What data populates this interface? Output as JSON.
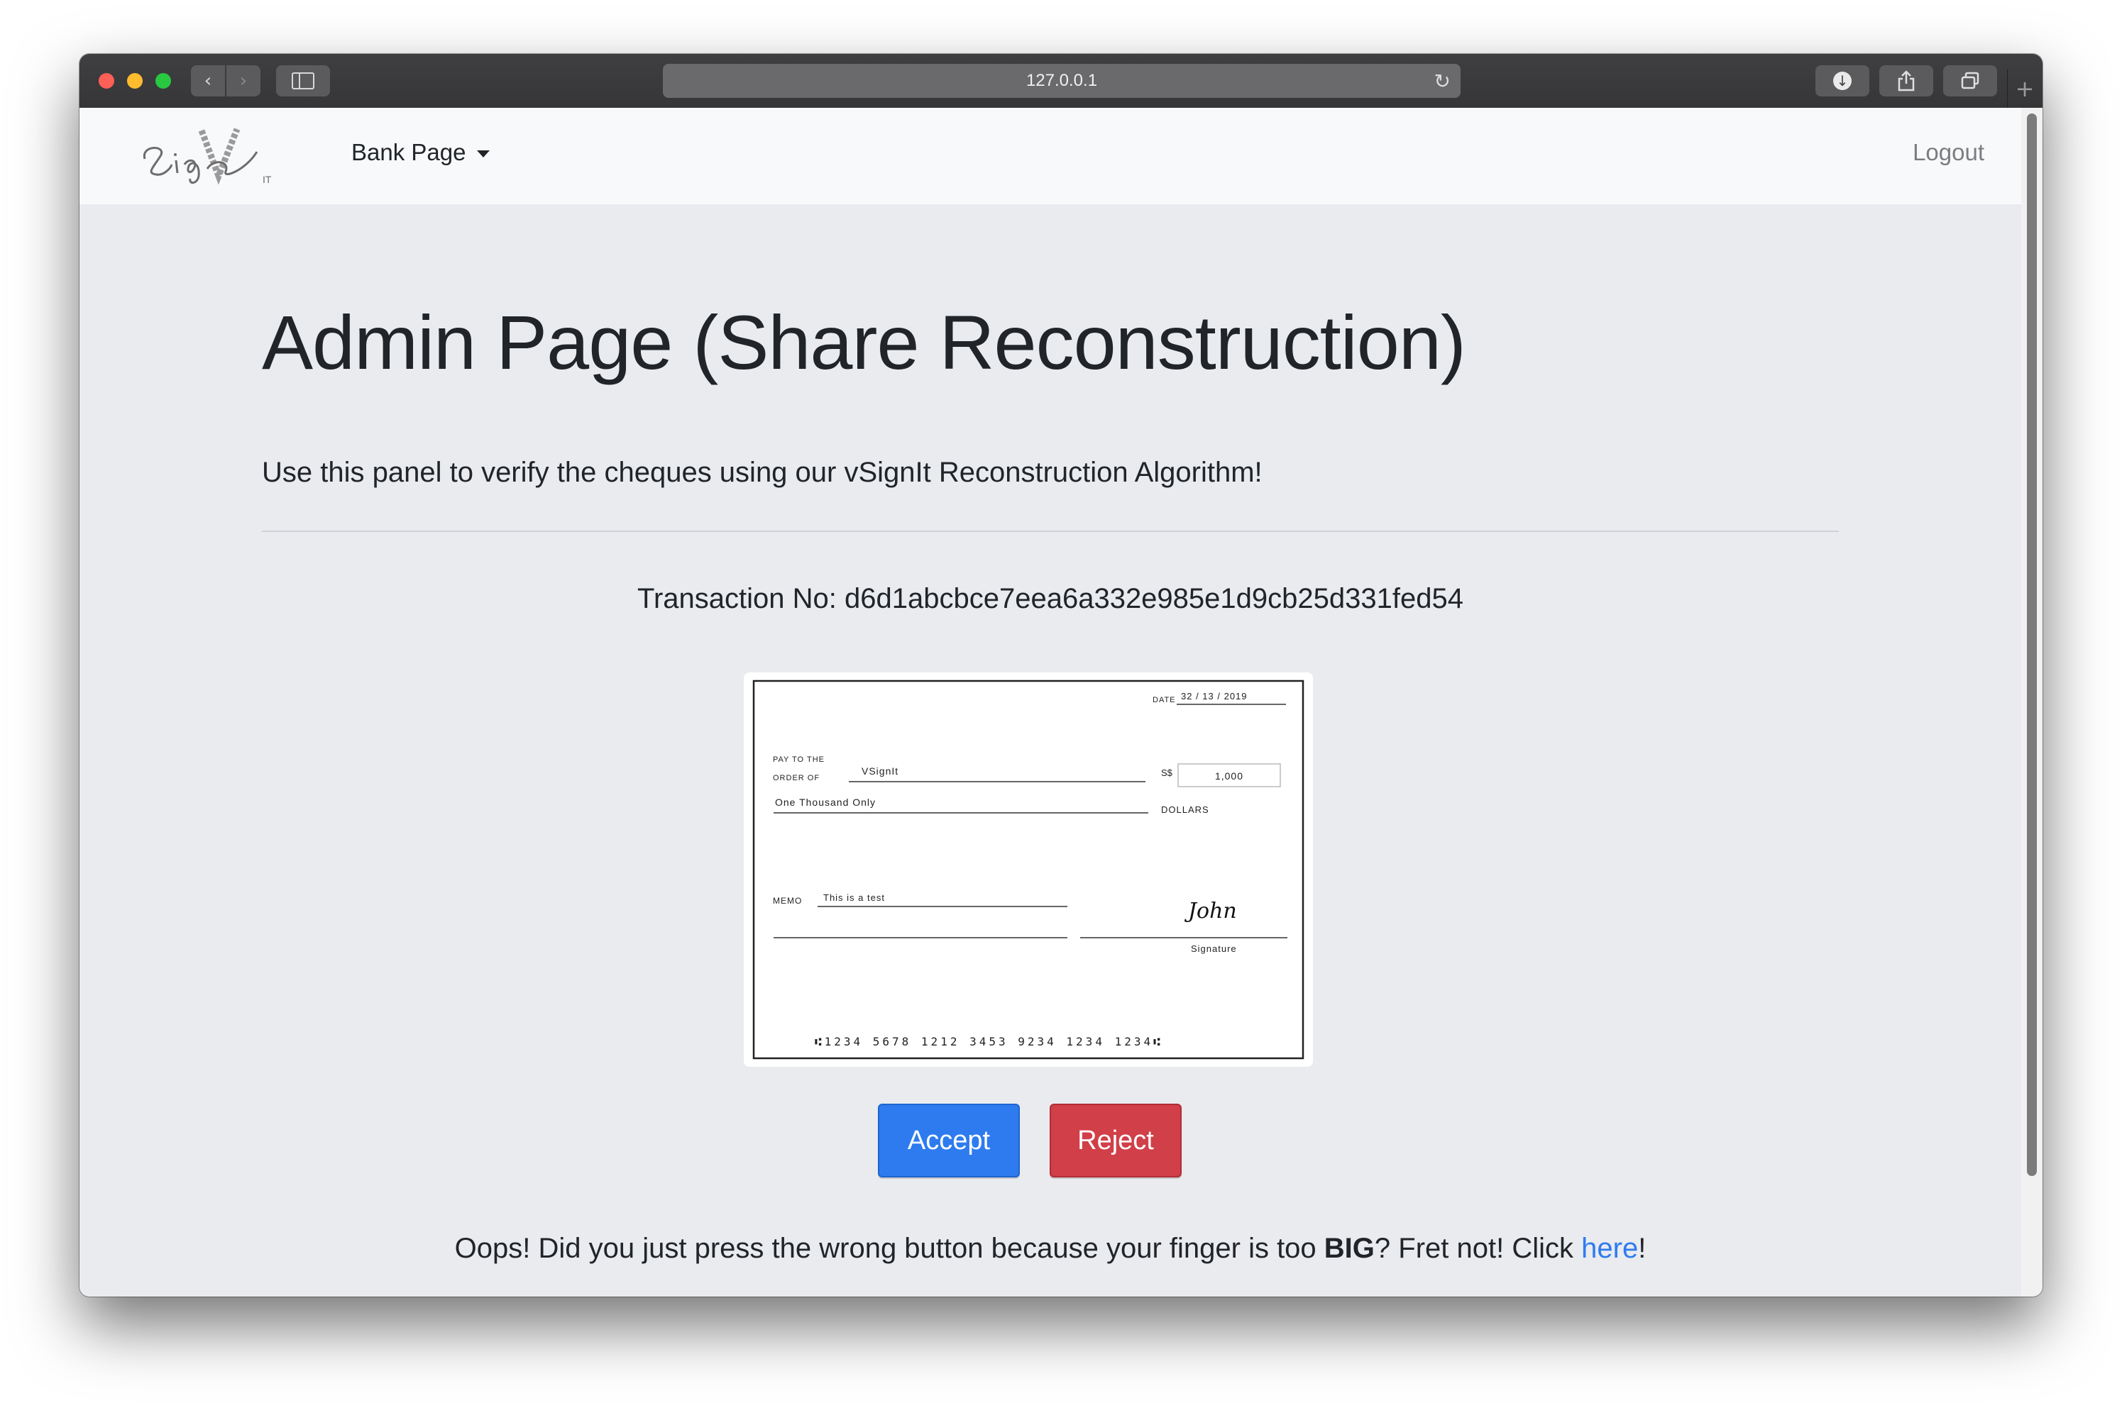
{
  "browser": {
    "url": "127.0.0.1"
  },
  "navbar": {
    "brand_alt": "vSignIt",
    "dropdown_label": "Bank Page",
    "logout_label": "Logout"
  },
  "main": {
    "title": "Admin Page (Share Reconstruction)",
    "lead": "Use this panel to verify the cheques using our vSignIt Reconstruction Algorithm!",
    "transaction_label": "Transaction No: ",
    "transaction_no": "d6d1abcbce7eea6a332e985e1d9cb25d331fed54"
  },
  "cheque": {
    "date_label": "DATE",
    "date_value": "32 / 13 / 2019",
    "pay_to_line1": "PAY TO THE",
    "pay_to_line2": "ORDER OF",
    "payee": "VSignIt",
    "currency": "S$",
    "amount": "1,000",
    "amount_words": "One Thousand Only",
    "dollars_label": "DOLLARS",
    "memo_label": "MEMO",
    "memo_value": "This is a test",
    "signature_text": "John",
    "signature_label": "Signature",
    "micr_line": "⑆1234 5678 1212 3453 9234 1234 1234⑆"
  },
  "actions": {
    "accept_label": "Accept",
    "reject_label": "Reject"
  },
  "footer": {
    "oops_prefix": "Oops! Did you just press the wrong button because your finger is too ",
    "oops_bold": "BIG",
    "oops_middle": "? Fret not! Click ",
    "oops_link": "here",
    "oops_suffix": "!"
  },
  "colors": {
    "accept": "#2e7bef",
    "reject": "#d13f48",
    "link": "#2f7bef",
    "page_bg": "#e9ebef",
    "navbar_bg": "#f8f9fa"
  },
  "icons": {
    "back": "chevron-left-icon",
    "forward": "chevron-right-icon",
    "sidebar": "sidebar-icon",
    "reload": "reload-icon",
    "download": "download-icon",
    "share": "share-icon",
    "tabs": "tabs-icon",
    "new_tab": "plus-icon"
  }
}
